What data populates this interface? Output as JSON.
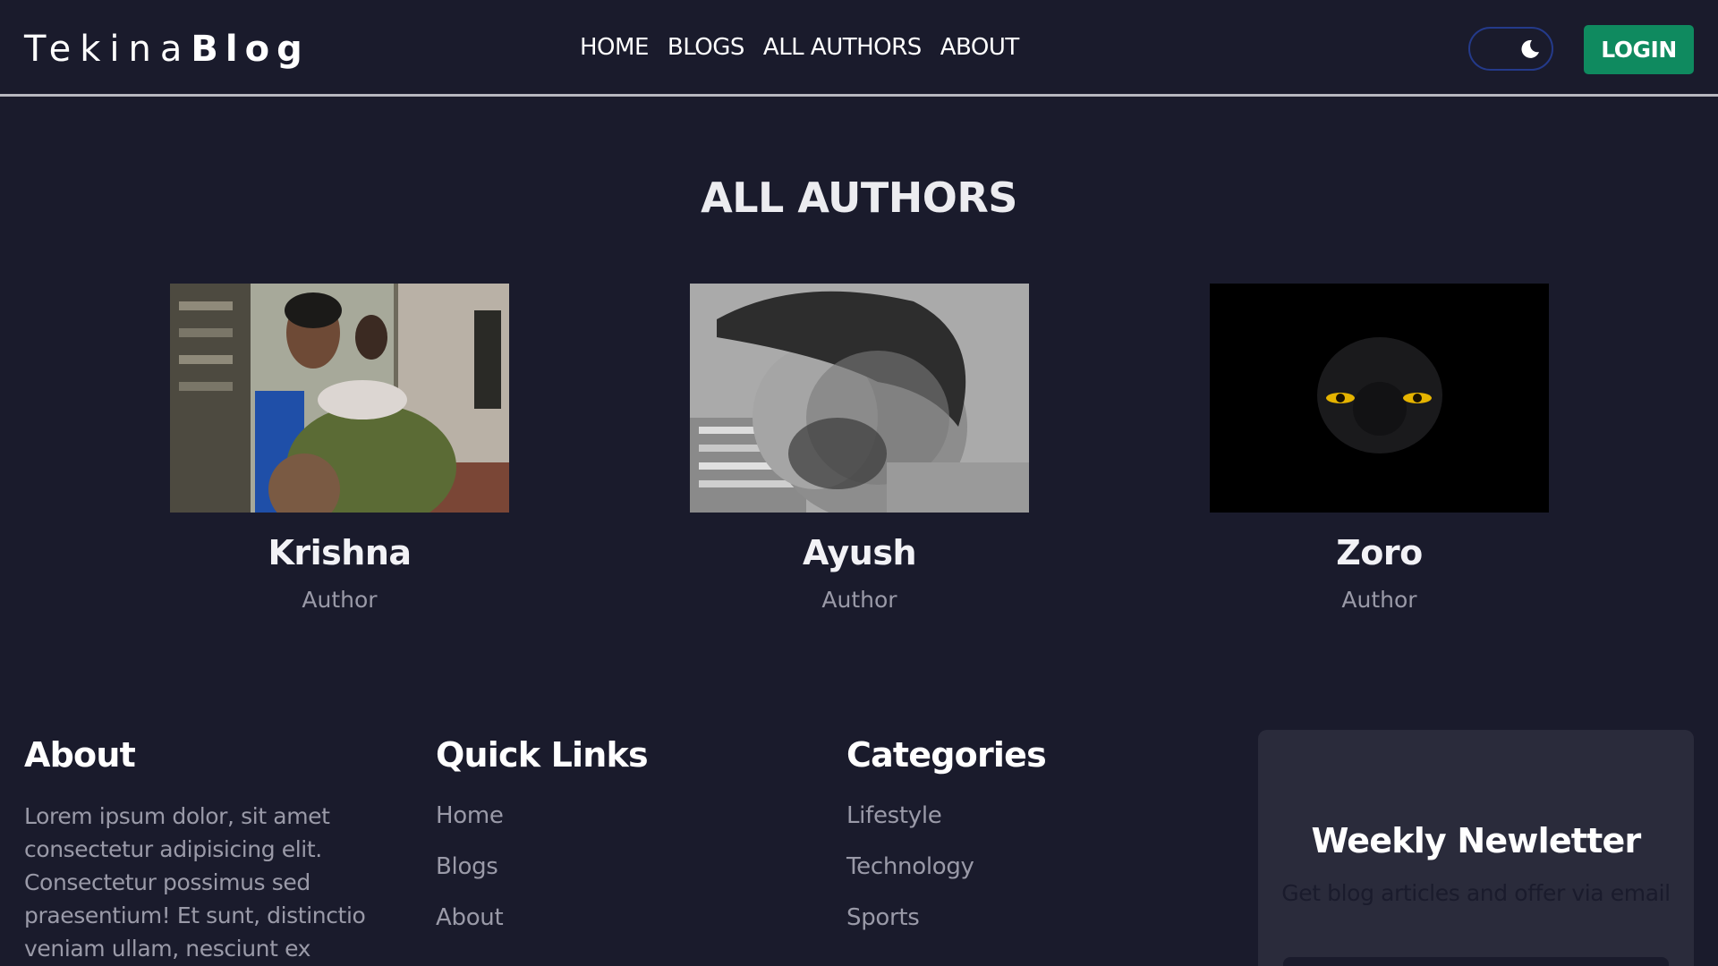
{
  "header": {
    "logo_light": "Tekina",
    "logo_bold": "Blog",
    "nav": [
      "HOME",
      "BLOGS",
      "ALL AUTHORS",
      "ABOUT"
    ],
    "login_label": "LOGIN",
    "theme_icon": "moon-icon"
  },
  "page_title": "ALL AUTHORS",
  "authors": [
    {
      "name": "Krishna",
      "role": "Author"
    },
    {
      "name": "Ayush",
      "role": "Author"
    },
    {
      "name": "Zoro",
      "role": "Author"
    }
  ],
  "footer": {
    "about": {
      "heading": "About",
      "text": "Lorem ipsum dolor, sit amet consectetur adipisicing elit. Consectetur possimus sed praesentium! Et sunt, distinctio veniam ullam, nesciunt ex"
    },
    "quick_links": {
      "heading": "Quick Links",
      "items": [
        "Home",
        "Blogs",
        "About"
      ]
    },
    "categories": {
      "heading": "Categories",
      "items": [
        "Lifestyle",
        "Technology",
        "Sports"
      ]
    },
    "newsletter": {
      "title": "Weekly Newletter",
      "subtitle": "Get blog articles and offer via email"
    }
  },
  "colors": {
    "background": "#1a1b2c",
    "accent": "#0f8a5f",
    "muted_text": "#9a9aa8",
    "card_bg": "#2a2b3b"
  }
}
